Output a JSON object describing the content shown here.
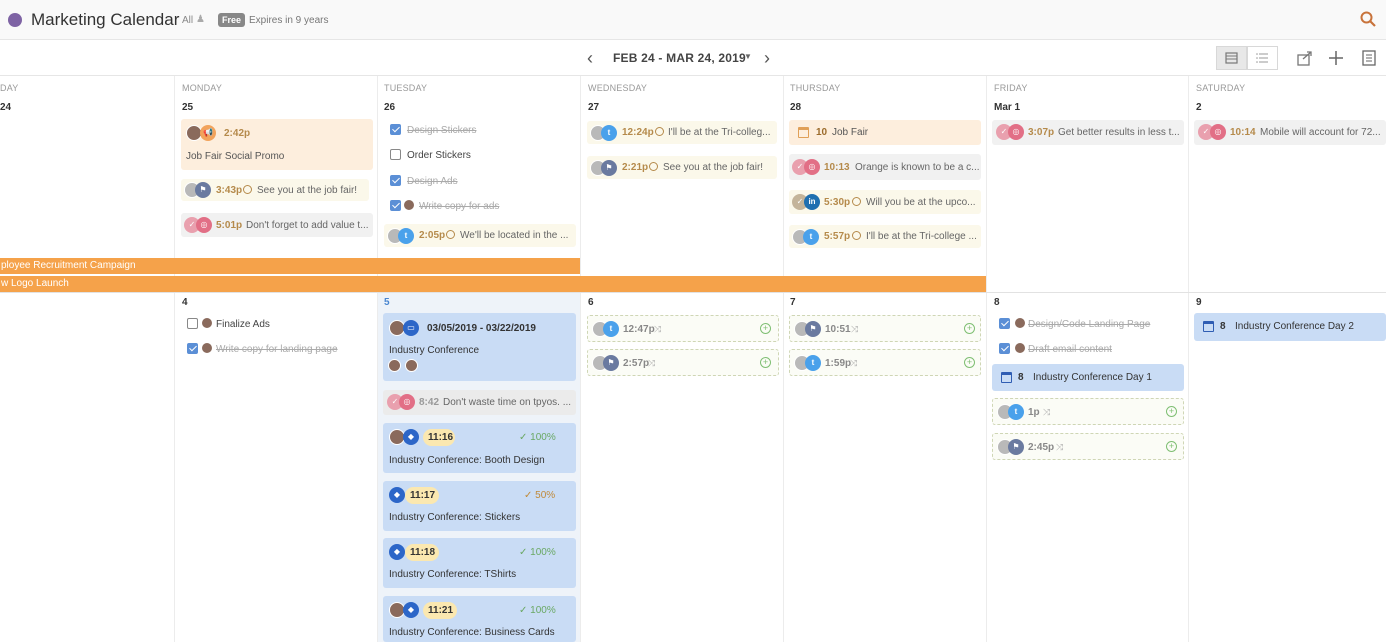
{
  "app": {
    "title": "Marketing Calendar",
    "filter": "All",
    "plan_badge": "Free",
    "expires": "Expires in 9 years",
    "search_icon": "search-icon",
    "accent": "#7e63a4"
  },
  "nav": {
    "range": "FEB 24 - MAR 24, 2019",
    "prev_icon": "chevron-left-icon",
    "next_icon": "chevron-right-icon",
    "view_icons": [
      "calendar-view-icon",
      "list-view-icon",
      "share-icon",
      "add-icon",
      "notes-icon"
    ]
  },
  "days": [
    "DAY",
    "MONDAY",
    "TUESDAY",
    "WEDNESDAY",
    "THURSDAY",
    "FRIDAY",
    "SATURDAY"
  ],
  "week1": {
    "dates": [
      "24",
      "25",
      "26",
      "27",
      "28",
      "Mar 1",
      "2"
    ]
  },
  "week2": {
    "dates": [
      "4",
      "5",
      "6",
      "7",
      "8",
      "9"
    ]
  },
  "campaigns": [
    "ployee Recruitment Campaign",
    "w Logo Launch"
  ],
  "mon1": [
    {
      "time": "2:42p",
      "text": "Job Fair Social Promo"
    },
    {
      "time": "3:43p",
      "text": "See you at the job fair!"
    },
    {
      "time": "5:01p",
      "text": "Don't forget to add value t..."
    }
  ],
  "tue1": [
    {
      "text": "Design Stickers",
      "done": true
    },
    {
      "text": "Order Stickers",
      "done": false
    },
    {
      "text": "Design Ads",
      "done": true
    },
    {
      "text": "Write copy for ads",
      "done": true
    },
    {
      "time": "2:05p",
      "text": "We'll be located in the ..."
    }
  ],
  "wed1": [
    {
      "time": "12:24p",
      "text": "I'll be at the Tri-colleg..."
    },
    {
      "time": "2:21p",
      "text": "See you at the job fair!"
    }
  ],
  "thu1": [
    {
      "count": "10",
      "text": "Job Fair"
    },
    {
      "time": "10:13",
      "text": "Orange is known to be a c..."
    },
    {
      "time": "5:30p",
      "text": "Will you be at the upco..."
    },
    {
      "time": "5:57p",
      "text": "I'll be at the Tri-college ..."
    }
  ],
  "fri1": [
    {
      "time": "3:07p",
      "text": "Get better results in less t..."
    }
  ],
  "sat1": [
    {
      "time": "10:14",
      "text": "Mobile will account for 72..."
    }
  ],
  "mon2": [
    {
      "text": "Finalize Ads",
      "done": false
    },
    {
      "text": "Write copy for landing page",
      "done": true
    }
  ],
  "tue2": {
    "conf": {
      "dates": "03/05/2019 - 03/22/2019",
      "title": "Industry Conference"
    },
    "social": {
      "time": "8:42",
      "text": "Don't waste time on tpyos. ..."
    },
    "tasks": [
      {
        "time": "11:16",
        "pct": "100%",
        "title": "Industry Conference: Booth Design"
      },
      {
        "time": "11:17",
        "pct": "50%",
        "title": "Industry Conference: Stickers"
      },
      {
        "time": "11:18",
        "pct": "100%",
        "title": "Industry Conference: TShirts"
      },
      {
        "time": "11:21",
        "pct": "100%",
        "title": "Industry Conference: Business Cards"
      }
    ]
  },
  "wed2": [
    {
      "time": "12:47p"
    },
    {
      "time": "2:57p"
    }
  ],
  "thu2": [
    {
      "time": "10:51"
    },
    {
      "time": "1:59p"
    }
  ],
  "fri2": {
    "tasks": [
      {
        "text": "Design/Code Landing Page",
        "done": true
      },
      {
        "text": "Draft email content",
        "done": true
      }
    ],
    "event": {
      "count": "8",
      "title": "Industry Conference Day 1"
    },
    "social": [
      {
        "time": "1p"
      },
      {
        "time": "2:45p"
      }
    ]
  },
  "sat2": {
    "event": {
      "count": "8",
      "title": "Industry Conference Day 2"
    }
  }
}
